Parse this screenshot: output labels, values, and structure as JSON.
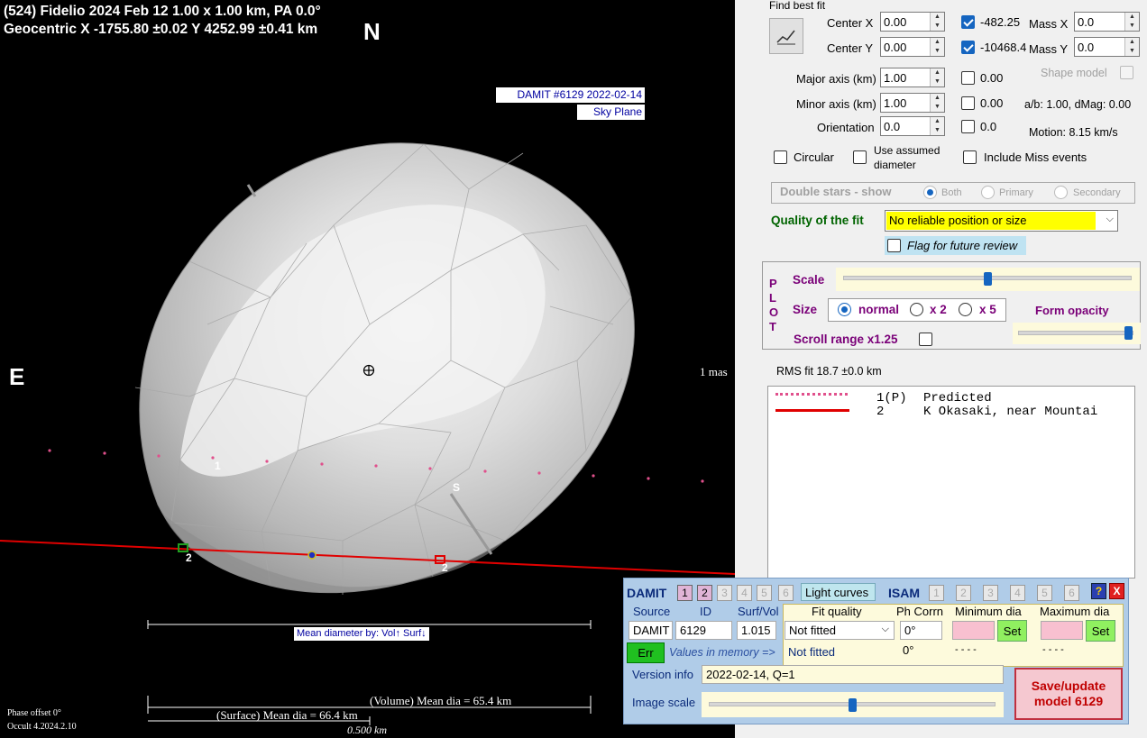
{
  "plot": {
    "header_line1": "(524) Fidelio  2024 Feb 12   1.00 x 1.00 km, PA 0.0°",
    "header_line2": "Geocentric  X  -1755.80 ±0.02  Y 4252.99 ±0.41 km",
    "north": "N",
    "east": "E",
    "south": "S",
    "damit_label": "DAMIT #6129 2022-02-14",
    "sky_plane": "Sky Plane",
    "scale_mas": "1 mas",
    "chord1_label": "1",
    "chord2_label_a": "2",
    "chord2_label_b": "2",
    "mean_diameter_by": "Mean diameter by: Vol↑ Surf↓",
    "volume_mean": "(Volume) Mean dia = 65.4 km",
    "surface_mean": "(Surface) Mean dia = 66.4 km",
    "scale_km": "0.500 km",
    "phase_offset": "Phase offset 0°",
    "version": "Occult 4.2024.2.10"
  },
  "fit": {
    "find_best_fit": "Find best fit",
    "center_x_label": "Center X",
    "center_x_value": "0.00",
    "center_x_result": "-482.25",
    "center_y_label": "Center Y",
    "center_y_value": "0.00",
    "center_y_result": "-10468.4",
    "mass_x_label": "Mass X",
    "mass_x_value": "0.0",
    "mass_y_label": "Mass Y",
    "mass_y_value": "0.0",
    "major_label": "Major axis (km)",
    "major_value": "1.00",
    "major_result": "0.00",
    "minor_label": "Minor axis (km)",
    "minor_value": "1.00",
    "minor_result": "0.00",
    "orient_label": "Orientation",
    "orient_value": "0.0",
    "orient_result": "0.0",
    "shape_model": "Shape model",
    "ab_dmag": "a/b: 1.00, dMag: 0.00",
    "motion": "Motion: 8.15 km/s",
    "circular": "Circular",
    "use_assumed_1": "Use assumed",
    "use_assumed_2": "diameter",
    "include_miss": "Include Miss events",
    "double_stars": "Double stars - show",
    "both": "Both",
    "primary": "Primary",
    "secondary": "Secondary",
    "quality_label": "Quality of the fit",
    "quality_value": "No reliable position or size",
    "flag_review": "Flag for future review"
  },
  "plotbox": {
    "side": [
      "P",
      "L",
      "O",
      "T"
    ],
    "scale": "Scale",
    "size": "Size",
    "normal": "normal",
    "x2": "x 2",
    "x5": "x 5",
    "form_opacity": "Form opacity",
    "scroll_range": "Scroll range x1.25",
    "scale_fraction": 0.5,
    "opacity_fraction": 0.95
  },
  "rms": "RMS fit 18.7 ±0.0 km",
  "legend": [
    {
      "num": "1(P)",
      "name": "Predicted"
    },
    {
      "num": "2",
      "name": "K Okasaki, near Mountai"
    }
  ],
  "dialog": {
    "damit": "DAMIT",
    "damit_nums": [
      "1",
      "2",
      "3",
      "4",
      "5",
      "6"
    ],
    "light_curves": "Light curves",
    "isam": "ISAM",
    "isam_nums": [
      "1",
      "2",
      "3",
      "4",
      "5",
      "6"
    ],
    "help": "?",
    "close": "X",
    "source_h": "Source",
    "id_h": "ID",
    "surfvol_h": "Surf/Vol",
    "fitq_h": "Fit quality",
    "phcorr_h": "Ph Corrn",
    "mindia_h": "Minimum dia",
    "maxdia_h": "Maximum dia",
    "source_v": "DAMIT",
    "id_v": "6129",
    "surfvol_v": "1.015",
    "fitq_v": "Not fitted",
    "phcorr_v": "0°",
    "set": "Set",
    "err": "Err",
    "values_mem": "Values in memory =>",
    "fitq_mem": "Not fitted",
    "phcorr_mem": "0°",
    "min_mem": "- - - -",
    "max_mem": "- - - -",
    "version_label": "Version info",
    "version_value": "2022-02-14, Q=1",
    "image_scale": "Image scale",
    "image_scale_fraction": 0.5,
    "save_1": "Save/update",
    "save_2": "model 6129"
  }
}
